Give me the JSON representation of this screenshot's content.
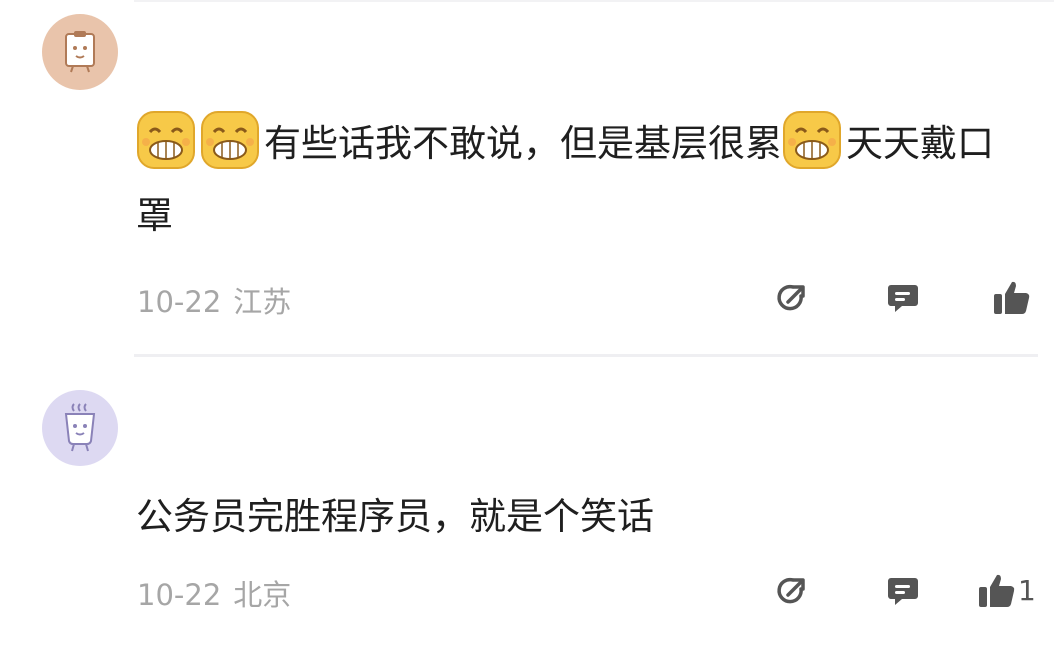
{
  "comments": [
    {
      "username": "",
      "avatar_icon": "note-character-icon",
      "avatar_color": "#e9c4ab",
      "emoji": "grinning-emoji",
      "text_parts": [
        "有些话我不敢说，但是基层很累",
        "天天戴口罩"
      ],
      "date": "10-22",
      "location": "江苏",
      "like_count": ""
    },
    {
      "username": "",
      "avatar_icon": "cup-character-icon",
      "avatar_color": "#ddd9f2",
      "text": "公务员完胜程序员，就是个笑话",
      "date": "10-22",
      "location": "北京",
      "like_count": "1"
    }
  ],
  "icons": {
    "share": "share-arrow-icon",
    "reply": "comment-bubble-icon",
    "like": "thumbs-up-icon"
  },
  "colors": {
    "icon": "#555555",
    "meta": "#a6a6a6",
    "text": "#1f1f1f"
  }
}
